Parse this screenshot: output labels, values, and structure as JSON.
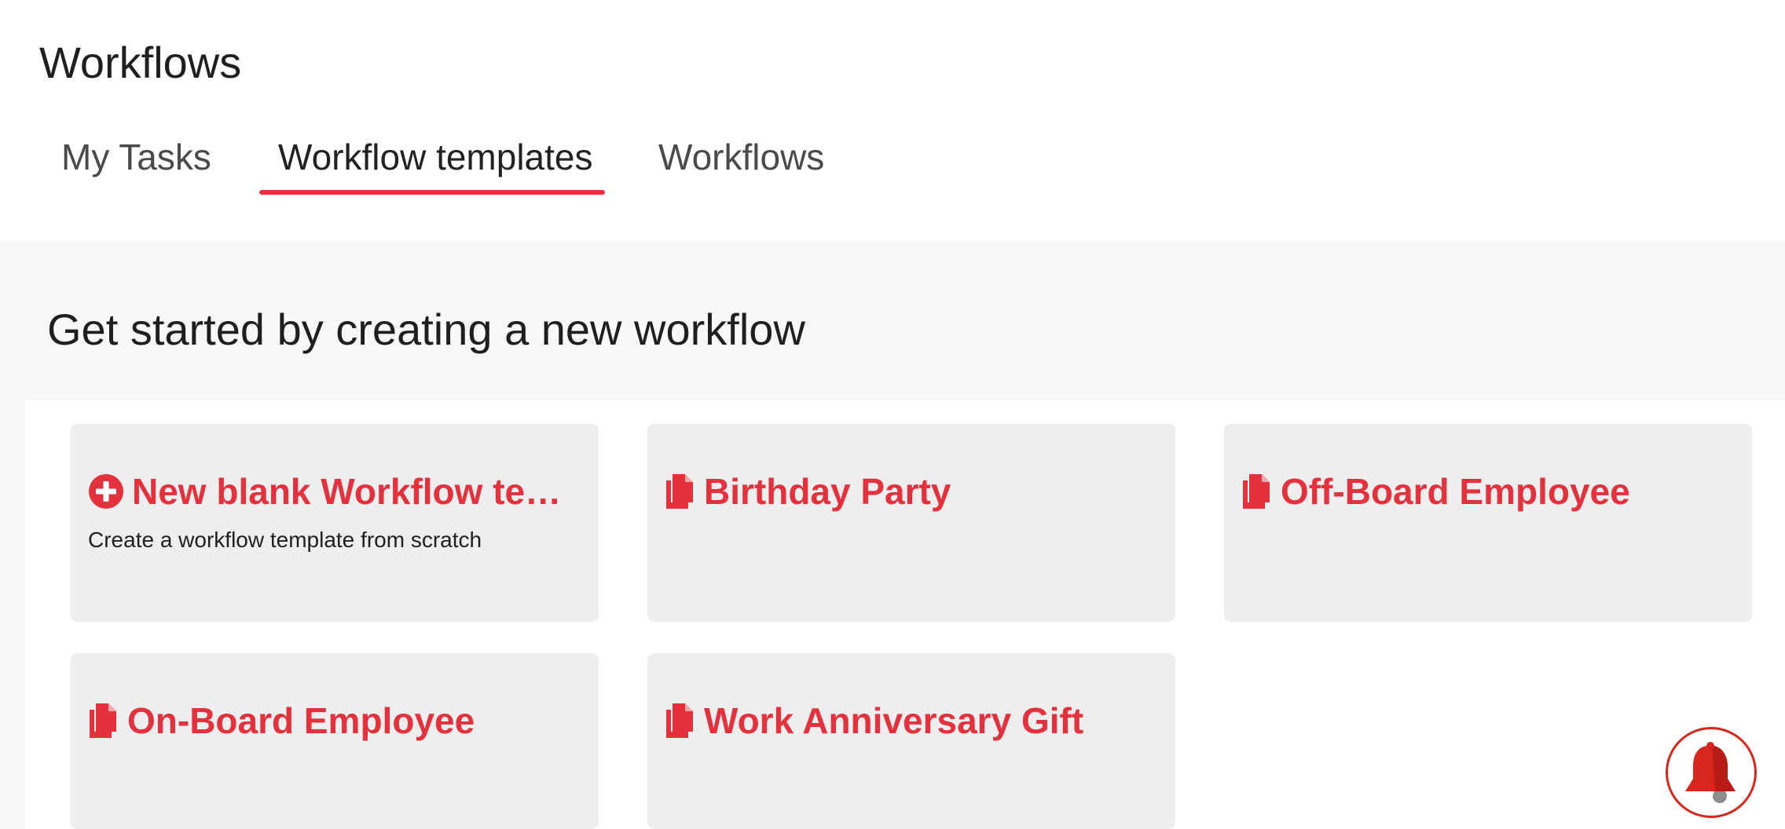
{
  "header": {
    "title": "Workflows"
  },
  "tabs": [
    {
      "label": "My Tasks",
      "active": false
    },
    {
      "label": "Workflow templates",
      "active": true
    },
    {
      "label": "Workflows",
      "active": false
    }
  ],
  "main": {
    "section_title": "Get started by creating a new workflow",
    "cards": [
      {
        "title": "New blank Workflow tem…",
        "subtitle": "Create a workflow template from scratch",
        "icon": "plus-circle-icon"
      },
      {
        "title": "Birthday Party",
        "icon": "copy-icon"
      },
      {
        "title": "Off-Board Employee",
        "icon": "copy-icon"
      },
      {
        "title": "On-Board Employee",
        "icon": "copy-icon"
      },
      {
        "title": "Work Anniversary Gift",
        "icon": "copy-icon"
      }
    ]
  },
  "notifications": {
    "icon": "bell-icon"
  },
  "colors": {
    "accent": "#e3313d",
    "tab_underline": "#e8323f",
    "card_bg": "#eeeeee",
    "band_bg": "#f7f8fa",
    "bell_red": "#d9261c"
  }
}
